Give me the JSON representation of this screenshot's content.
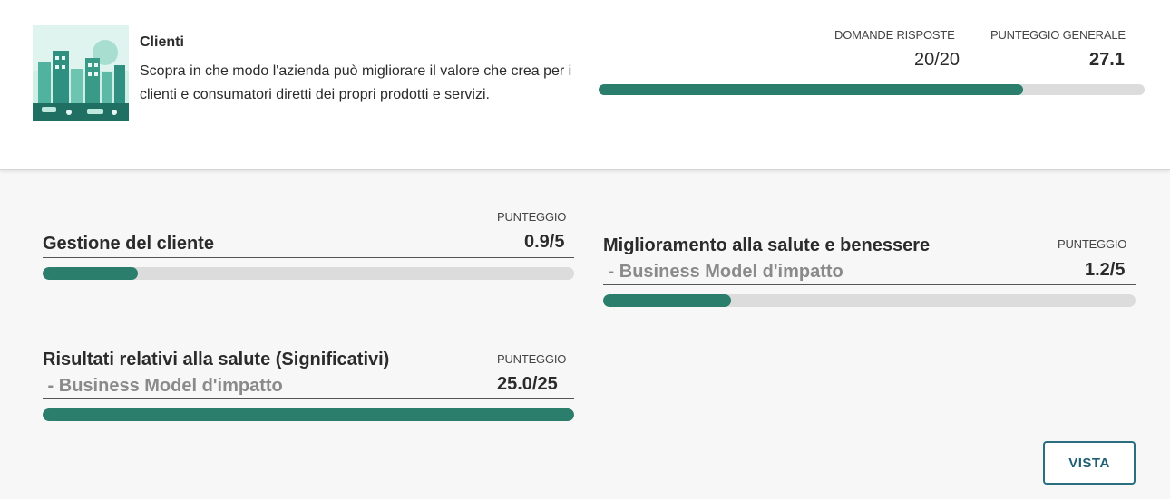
{
  "header": {
    "category_title": "Clienti",
    "category_description": "Scopra in che modo l'azienda può migliorare il valore che crea per i clienti e consumatori diretti dei propri prodotti e servizi.",
    "questions_label": "DOMANDE RISPOSTE",
    "questions_value": "20/20",
    "overall_label": "PUNTEGGIO GENERALE",
    "overall_value": "27.1",
    "progress_fraction": 0.777
  },
  "sections": [
    {
      "title": "Gestione del cliente",
      "subtitle": "",
      "score_label": "PUNTEGGIO",
      "score": "0.9/5",
      "progress_fraction": 0.18
    },
    {
      "title": "Miglioramento alla salute e benessere",
      "subtitle": " - Business Model d'impatto",
      "score_label": "PUNTEGGIO",
      "score": "1.2/5",
      "progress_fraction": 0.24
    },
    {
      "title": "Risultati relativi alla salute (Significativi)",
      "subtitle": " - Business Model d'impatto",
      "score_label": "PUNTEGGIO",
      "score": "25.0/25",
      "progress_fraction": 1.0
    }
  ],
  "actions": {
    "view_label": "VISTA"
  },
  "colors": {
    "accent": "#2b7d6c",
    "track": "#dcdcdc",
    "button": "#2a6e7f"
  }
}
